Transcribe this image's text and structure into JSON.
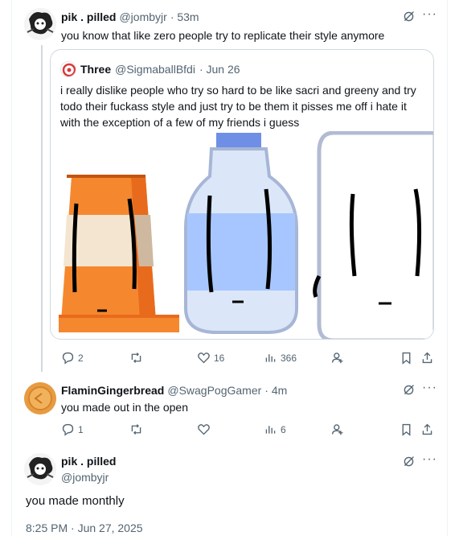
{
  "tweet1": {
    "name": "pik . pilled",
    "handle": "@jombyjr",
    "time": "· 53m",
    "text": "you know that like zero people try to replicate their style anymore"
  },
  "quote": {
    "name": "Three",
    "handle": "@SigmaballBfdi",
    "time": "· Jun 26",
    "text": "i really dislike people who try so hard to be like sacri and greeny and try todo their fuckass style and just try to be them it pisses me off i hate it with the exception of a few of my friends i guess"
  },
  "tweet1_actions": {
    "replies": "2",
    "retweets": "",
    "likes": "16",
    "views": "366"
  },
  "reply": {
    "name": "FlaminGingerbread",
    "handle": "@SwagPogGamer",
    "time": "· 4m",
    "text": "you made out in the open"
  },
  "reply_actions": {
    "replies": "1",
    "retweets": "",
    "likes": "",
    "views": "6"
  },
  "main": {
    "name": "pik . pilled",
    "handle": "@jombyjr",
    "text": "you made monthly",
    "timestamp": "8:25 PM · Jun 27, 2025"
  },
  "icons": {
    "more": "more-icon",
    "grok": "grok-icon",
    "reply": "reply-icon",
    "retweet": "retweet-icon",
    "like": "like-icon",
    "views": "views-icon",
    "bookmark": "bookmark-icon",
    "share": "share-icon",
    "follow": "follow-icon"
  },
  "colors": {
    "text": "#0f1419",
    "muted": "#536471",
    "border": "#cfd9de"
  }
}
